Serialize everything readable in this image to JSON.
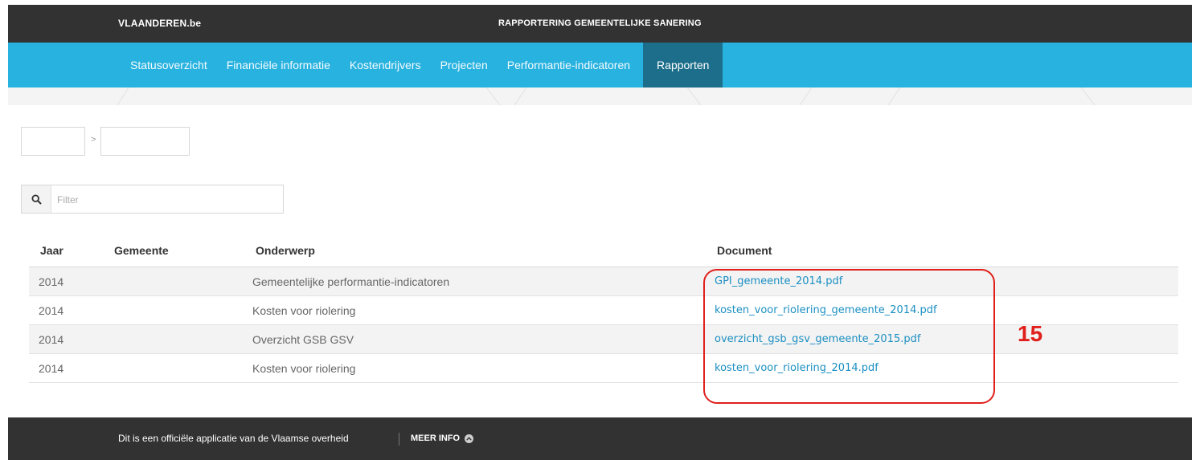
{
  "header": {
    "brand": "VLAANDEREN.be",
    "app_title": "RAPPORTERING GEMEENTELIJKE SANERING"
  },
  "nav": {
    "items": [
      {
        "label": "Statusoverzicht"
      },
      {
        "label": "Financiële informatie"
      },
      {
        "label": "Kostendrijvers"
      },
      {
        "label": "Projecten"
      },
      {
        "label": "Performantie-indicatoren"
      },
      {
        "label": "Rapporten",
        "active": true
      }
    ]
  },
  "breadcrumb": {
    "separator": ">"
  },
  "filter": {
    "placeholder": "Filter",
    "icon": "search-icon"
  },
  "table": {
    "headers": {
      "year": "Jaar",
      "municipality": "Gemeente",
      "subject": "Onderwerp",
      "document": "Document"
    },
    "rows": [
      {
        "year": "2014",
        "municipality": "",
        "subject": "Gemeentelijke performantie-indicatoren",
        "document": "GPI_gemeente_2014.pdf"
      },
      {
        "year": "2014",
        "municipality": "",
        "subject": "Kosten voor riolering",
        "document": "kosten_voor_riolering_gemeente_2014.pdf"
      },
      {
        "year": "2014",
        "municipality": "",
        "subject": "Overzicht GSB GSV",
        "document": "overzicht_gsb_gsv_gemeente_2015.pdf"
      },
      {
        "year": "2014",
        "municipality": "",
        "subject": "Kosten voor riolering",
        "document": "kosten_voor_riolering_2014.pdf"
      }
    ]
  },
  "annotation": {
    "number": "15",
    "color": "#e0201c"
  },
  "footer": {
    "text": "Dit is een officiële applicatie van de Vlaamse overheid",
    "more_label": "MEER INFO",
    "more_icon": "chevron-up-circle-icon"
  },
  "colors": {
    "topbar": "#333232",
    "nav": "#28b2df",
    "nav_active": "#1d6e8a",
    "link": "#1b8fc2"
  }
}
